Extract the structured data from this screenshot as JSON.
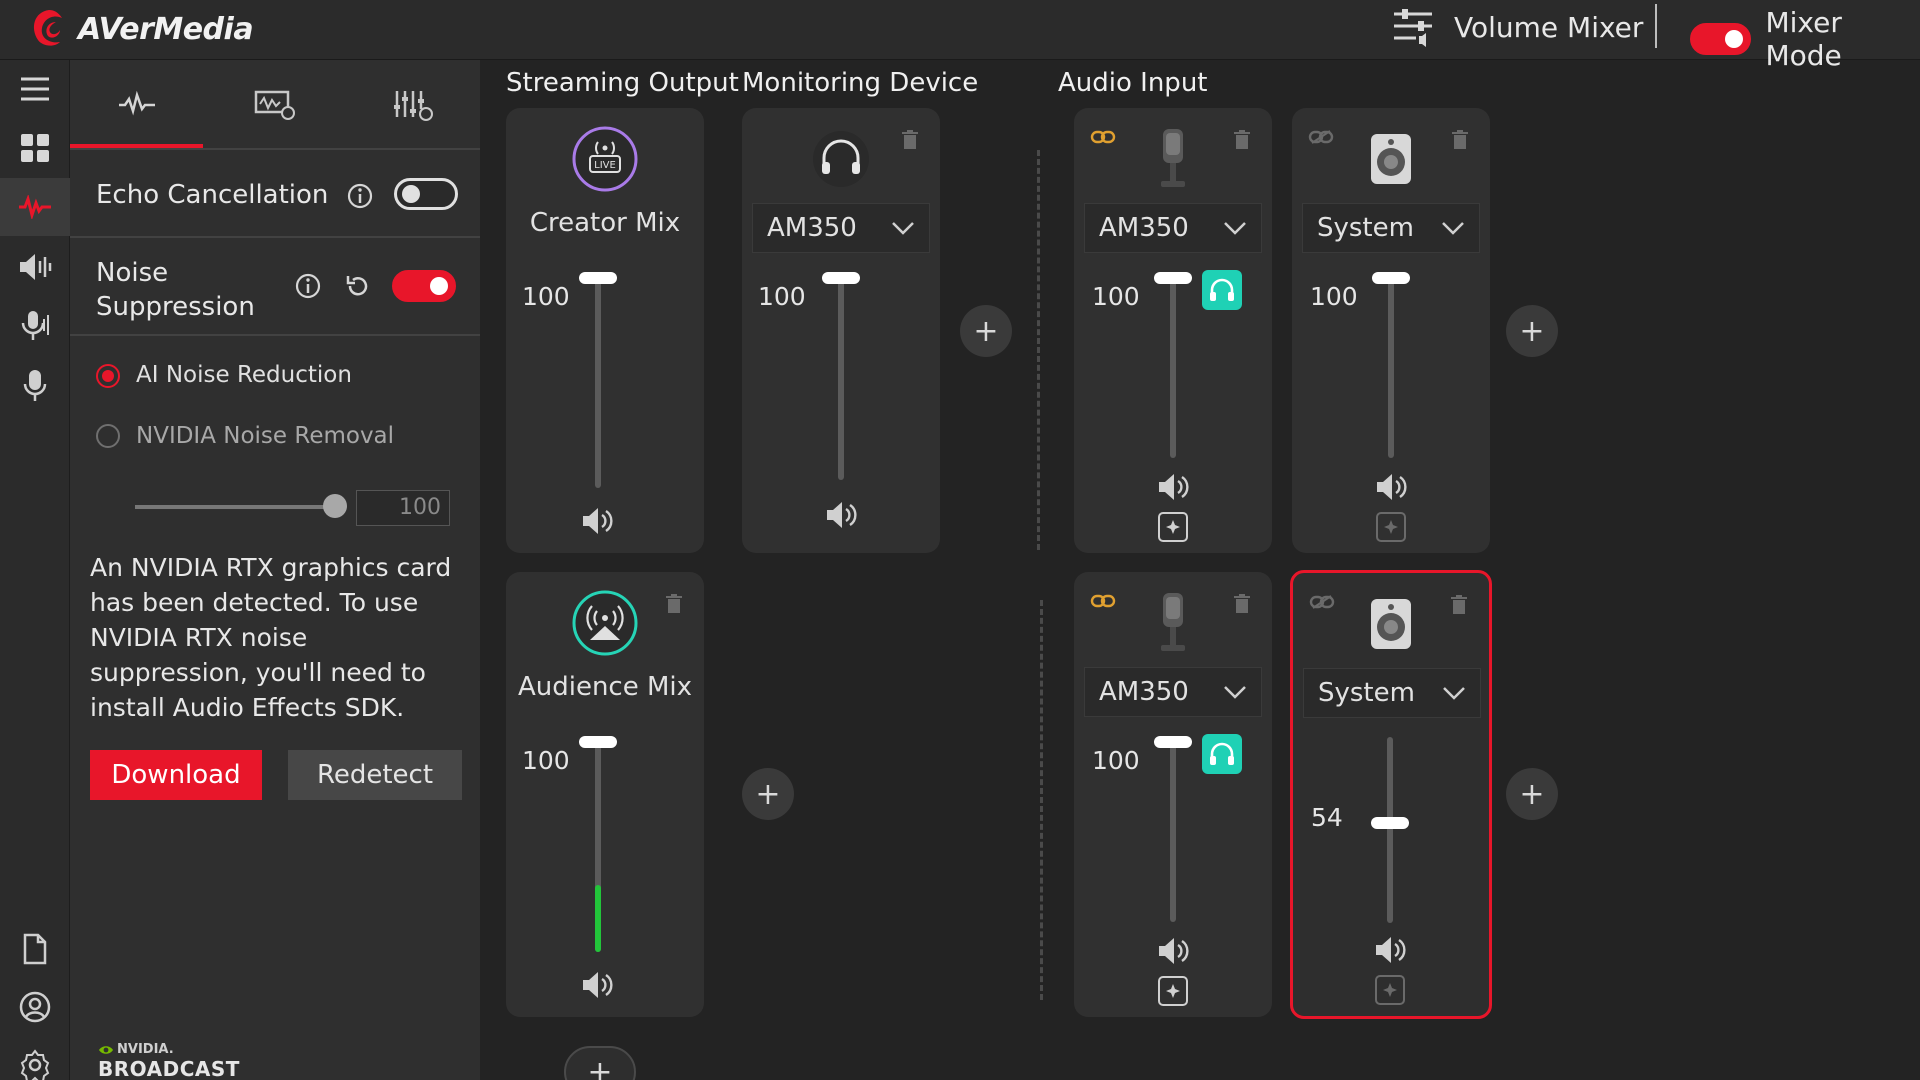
{
  "app": {
    "brand": "AVerMedia",
    "volume_mixer_label": "Volume Mixer",
    "mixer_mode_label": "Mixer Mode",
    "mixer_mode_on": true
  },
  "rail": {
    "icons": [
      "menu-icon",
      "dashboard-icon",
      "waveform-icon",
      "speaker-icon",
      "mic-stand-icon",
      "microphone-icon",
      "document-icon",
      "account-icon",
      "settings-icon"
    ],
    "active_index": 2
  },
  "panel": {
    "tabs": [
      "waveform-tab-icon",
      "audio-effect-tab-icon",
      "equalizer-tab-icon"
    ],
    "active_tab": 0,
    "echo_cancellation": {
      "label": "Echo Cancellation",
      "on": false
    },
    "noise_suppression": {
      "label": "Noise\nSuppression",
      "on": true
    },
    "options": [
      {
        "label": "AI Noise Reduction",
        "selected": true
      },
      {
        "label": "NVIDIA Noise Removal",
        "selected": false
      }
    ],
    "strength_value": "100",
    "notice": "An NVIDIA RTX graphics card has been detected. To use NVIDIA RTX noise suppression, you'll need to install Audio Effects SDK.",
    "download_label": "Download",
    "redetect_label": "Redetect",
    "brand_small": "NVIDIA.",
    "brand_large": "BROADCAST"
  },
  "sections": {
    "streaming_output": "Streaming Output",
    "monitoring_device": "Monitoring Device",
    "audio_input": "Audio Input"
  },
  "streaming": {
    "creator_mix": {
      "title": "Creator Mix",
      "volume": "100",
      "level": 1.0
    },
    "audience_mix": {
      "title": "Audience Mix",
      "volume": "100",
      "level": 1.0,
      "meter": 0.32
    }
  },
  "monitoring": {
    "device": "AM350",
    "volume": "100",
    "level": 1.0
  },
  "inputs": {
    "creator_mic": {
      "device": "AM350",
      "volume": "100",
      "level": 1.0
    },
    "creator_system": {
      "device": "System",
      "volume": "100",
      "level": 1.0
    },
    "audience_mic": {
      "device": "AM350",
      "volume": "100",
      "level": 1.0
    },
    "audience_system": {
      "device": "System",
      "volume": "54",
      "level": 0.54
    }
  },
  "colors": {
    "accent": "#e8162a",
    "monitor": "#1fd1b5",
    "meter": "#22c53a"
  }
}
